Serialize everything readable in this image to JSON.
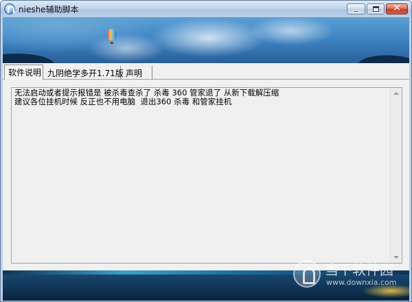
{
  "window": {
    "title": "nieshe辅助脚本",
    "controls": {
      "minimize": "minimize",
      "maximize": "maximize",
      "close": "✕"
    }
  },
  "tabs": [
    {
      "label": "软件说明",
      "active": true
    },
    {
      "label": "九阴绝学多开1.71版",
      "active": false
    },
    {
      "label": "声明",
      "active": false
    }
  ],
  "memo": {
    "lines": [
      "无法启动或者提示报错是 被杀毒查杀了 杀毒 360 管家退了 从新下载解压缩",
      "建议各位挂机时候 反正也不用电脑  退出360 杀毒 和管家挂机"
    ]
  },
  "watermark": {
    "title": "当下软件园",
    "url": "www.downxia.com"
  },
  "icons": {
    "app": "app-icon",
    "minimize": "minimize-icon",
    "maximize": "maximize-icon",
    "close": "close-icon",
    "scroll_up": "scroll-up-arrow-icon",
    "scroll_down": "scroll-down-arrow-icon",
    "watermark_logo": "downxia-logo-icon"
  },
  "colors": {
    "titlebar": "#c3d6ec",
    "close_button": "#c23d26",
    "content_background": "#f0f0f0"
  }
}
